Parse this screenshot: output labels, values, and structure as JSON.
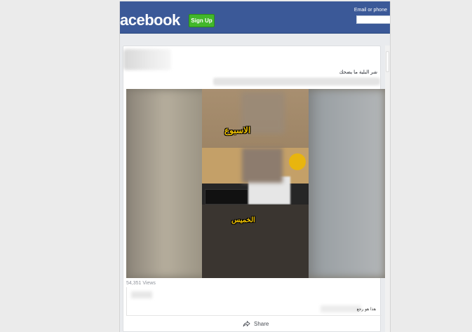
{
  "header": {
    "logo_text": "acebook",
    "signup_label": "Sign Up",
    "email_label": "Email or phone",
    "email_value": ""
  },
  "post": {
    "text": "شر البلية ما يضحك",
    "video": {
      "caption_top": "الاسبوع",
      "caption_bottom": "الخميس"
    },
    "views": "54,351 Views",
    "comment_text": "هذا هو رجع",
    "share_label": "Share"
  },
  "icons": {
    "share": "share-icon"
  },
  "colors": {
    "header_bg": "#3b5998",
    "signup_bg": "#42b72a",
    "caption": "#f2c300"
  }
}
